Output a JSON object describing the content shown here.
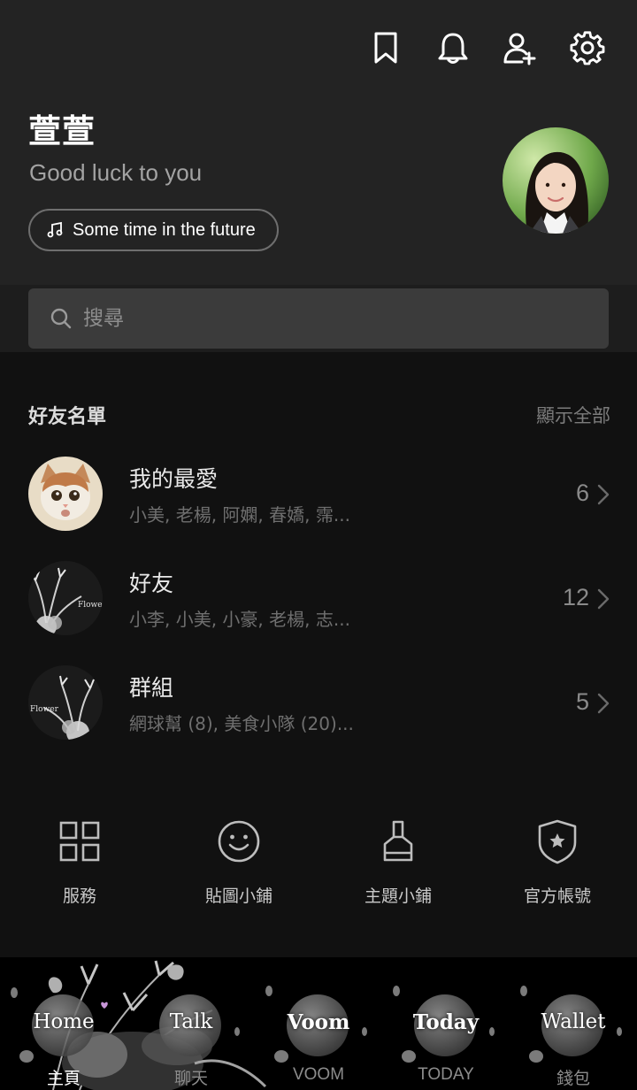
{
  "header": {
    "icons": [
      "bookmark-icon",
      "bell-icon",
      "add-friend-icon",
      "gear-icon"
    ],
    "profile": {
      "name": "萱萱",
      "status": "Good luck to you",
      "music": "Some time in the future"
    }
  },
  "search": {
    "placeholder": "搜尋"
  },
  "friends": {
    "title": "好友名單",
    "show_all": "顯示全部",
    "items": [
      {
        "title": "我的最愛",
        "subtitle": "小美, 老楊, 阿嫻, 春嬌, 霈...",
        "count": "6",
        "thumb": "cat"
      },
      {
        "title": "好友",
        "subtitle": "小李, 小美, 小豪, 老楊, 志...",
        "count": "12",
        "thumb": "flower"
      },
      {
        "title": "群組",
        "subtitle": "網球幫 (8), 美食小隊 (20)...",
        "count": "5",
        "thumb": "flower"
      }
    ]
  },
  "services": [
    {
      "label": "服務",
      "icon": "grid-icon"
    },
    {
      "label": "貼圖小鋪",
      "icon": "smiley-icon"
    },
    {
      "label": "主題小鋪",
      "icon": "brush-icon"
    },
    {
      "label": "官方帳號",
      "icon": "shield-star-icon"
    }
  ],
  "bottom_nav": {
    "tabs": [
      {
        "word": "Home",
        "label": "主頁",
        "active": true
      },
      {
        "word": "Talk",
        "label": "聊天",
        "active": false
      },
      {
        "word": "Voom",
        "label": "VOOM",
        "active": false
      },
      {
        "word": "Today",
        "label": "TODAY",
        "active": false
      },
      {
        "word": "Wallet",
        "label": "錢包",
        "active": false
      }
    ]
  },
  "colors": {
    "header_bg": "#232323",
    "page_bg": "#111111",
    "search_bg": "#3b3b3b"
  }
}
